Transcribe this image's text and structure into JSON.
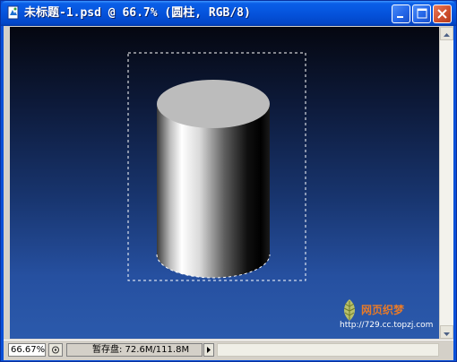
{
  "window": {
    "title": "未标题-1.psd @ 66.7% (圆柱, RGB/8)"
  },
  "icons": {
    "app": "photoshop-document-icon",
    "minimize": "minimize-icon",
    "maximize": "maximize-icon",
    "close": "close-icon"
  },
  "statusbar": {
    "zoom": "66.67%",
    "scratch_label": "暂存盘: 72.6M/111.8M"
  },
  "watermark": {
    "name": "网页织梦",
    "url": "http://729.cc.topzj.com"
  },
  "colors": {
    "titlebar": "#0553dc",
    "canvas_top": "#050710",
    "canvas_bottom": "#2b5aac",
    "watermark_text": "#e67a2a"
  }
}
